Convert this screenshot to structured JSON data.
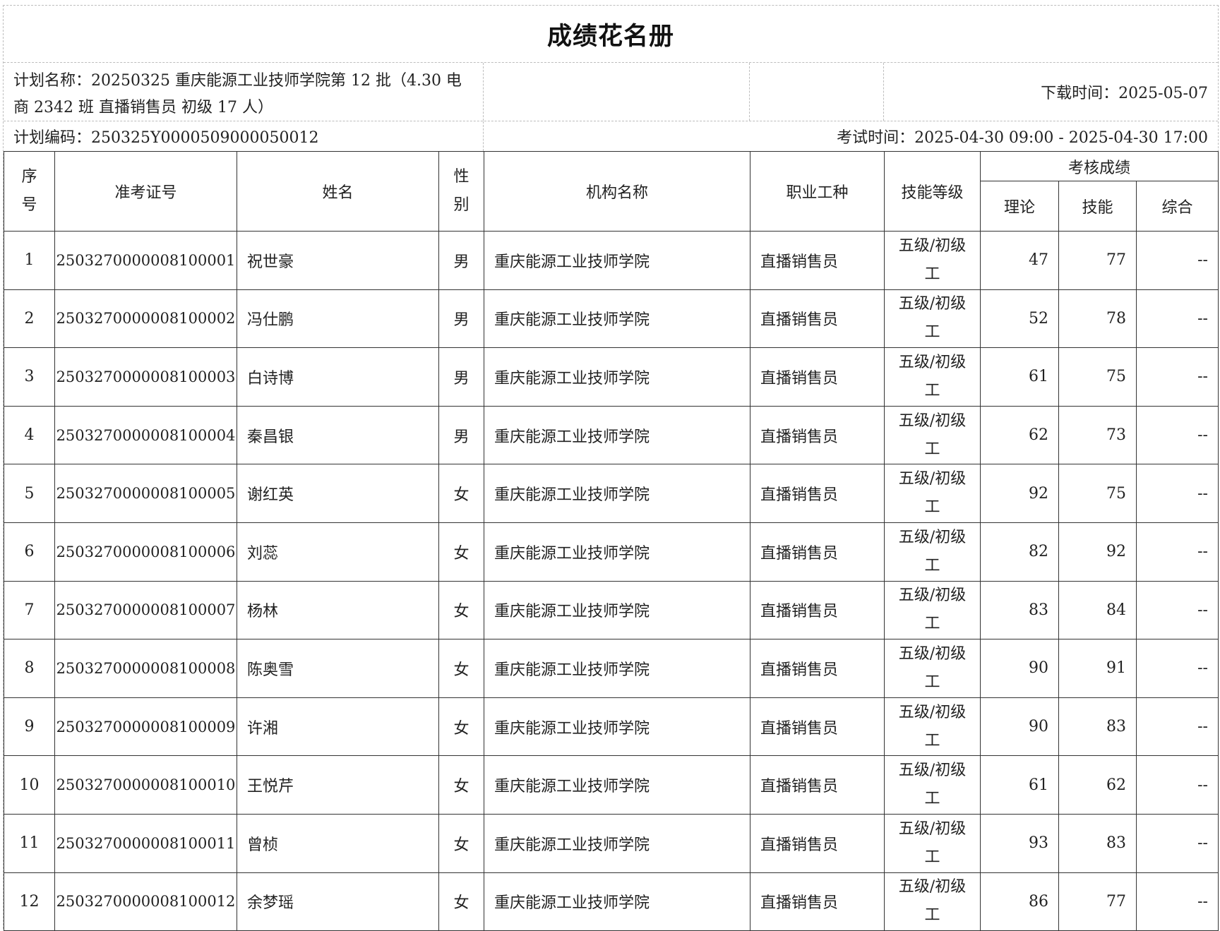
{
  "title": "成绩花名册",
  "info": {
    "plan_name_line1": "计划名称：20250325 重庆能源工业技师学院第 12 批（4.30 电",
    "plan_name_line2": "商 2342 班 直播销售员 初级 17 人）",
    "download_time": "下载时间：2025-05-07",
    "plan_code": "计划编码：250325Y0000509000050012",
    "exam_time": "考试时间：2025-04-30 09:00 - 2025-04-30 17:00"
  },
  "columns": {
    "index_1": "序",
    "index_2": "号",
    "ticket": "准考证号",
    "name": "姓名",
    "gender_1": "性",
    "gender_2": "别",
    "org": "机构名称",
    "occupation": "职业工种",
    "level": "技能等级",
    "score_group": "考核成绩",
    "theory": "理论",
    "skill": "技能",
    "overall": "综合"
  },
  "rows": [
    {
      "no": "1",
      "ticket": "2503270000008100001",
      "name": "祝世豪",
      "gender": "男",
      "org": "重庆能源工业技师学院",
      "occupation": "直播销售员",
      "level_1": "五级/初级",
      "level_2": "工",
      "theory": "47",
      "skill": "77",
      "overall": "--"
    },
    {
      "no": "2",
      "ticket": "2503270000008100002",
      "name": "冯仕鹏",
      "gender": "男",
      "org": "重庆能源工业技师学院",
      "occupation": "直播销售员",
      "level_1": "五级/初级",
      "level_2": "工",
      "theory": "52",
      "skill": "78",
      "overall": "--"
    },
    {
      "no": "3",
      "ticket": "2503270000008100003",
      "name": "白诗博",
      "gender": "男",
      "org": "重庆能源工业技师学院",
      "occupation": "直播销售员",
      "level_1": "五级/初级",
      "level_2": "工",
      "theory": "61",
      "skill": "75",
      "overall": "--"
    },
    {
      "no": "4",
      "ticket": "2503270000008100004",
      "name": "秦昌银",
      "gender": "男",
      "org": "重庆能源工业技师学院",
      "occupation": "直播销售员",
      "level_1": "五级/初级",
      "level_2": "工",
      "theory": "62",
      "skill": "73",
      "overall": "--"
    },
    {
      "no": "5",
      "ticket": "2503270000008100005",
      "name": "谢红英",
      "gender": "女",
      "org": "重庆能源工业技师学院",
      "occupation": "直播销售员",
      "level_1": "五级/初级",
      "level_2": "工",
      "theory": "92",
      "skill": "75",
      "overall": "--"
    },
    {
      "no": "6",
      "ticket": "2503270000008100006",
      "name": "刘蕊",
      "gender": "女",
      "org": "重庆能源工业技师学院",
      "occupation": "直播销售员",
      "level_1": "五级/初级",
      "level_2": "工",
      "theory": "82",
      "skill": "92",
      "overall": "--"
    },
    {
      "no": "7",
      "ticket": "2503270000008100007",
      "name": "杨林",
      "gender": "女",
      "org": "重庆能源工业技师学院",
      "occupation": "直播销售员",
      "level_1": "五级/初级",
      "level_2": "工",
      "theory": "83",
      "skill": "84",
      "overall": "--"
    },
    {
      "no": "8",
      "ticket": "2503270000008100008",
      "name": "陈奥雪",
      "gender": "女",
      "org": "重庆能源工业技师学院",
      "occupation": "直播销售员",
      "level_1": "五级/初级",
      "level_2": "工",
      "theory": "90",
      "skill": "91",
      "overall": "--"
    },
    {
      "no": "9",
      "ticket": "2503270000008100009",
      "name": "许湘",
      "gender": "女",
      "org": "重庆能源工业技师学院",
      "occupation": "直播销售员",
      "level_1": "五级/初级",
      "level_2": "工",
      "theory": "90",
      "skill": "83",
      "overall": "--"
    },
    {
      "no": "10",
      "ticket": "2503270000008100010",
      "name": "王悦芹",
      "gender": "女",
      "org": "重庆能源工业技师学院",
      "occupation": "直播销售员",
      "level_1": "五级/初级",
      "level_2": "工",
      "theory": "61",
      "skill": "62",
      "overall": "--"
    },
    {
      "no": "11",
      "ticket": "2503270000008100011",
      "name": "曾桢",
      "gender": "女",
      "org": "重庆能源工业技师学院",
      "occupation": "直播销售员",
      "level_1": "五级/初级",
      "level_2": "工",
      "theory": "93",
      "skill": "83",
      "overall": "--"
    },
    {
      "no": "12",
      "ticket": "2503270000008100012",
      "name": "余梦瑶",
      "gender": "女",
      "org": "重庆能源工业技师学院",
      "occupation": "直播销售员",
      "level_1": "五级/初级",
      "level_2": "工",
      "theory": "86",
      "skill": "77",
      "overall": "--"
    }
  ]
}
